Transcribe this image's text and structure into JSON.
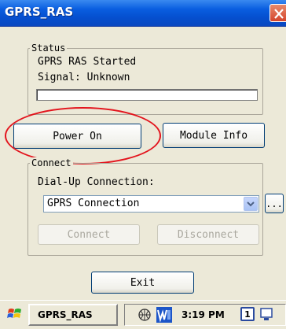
{
  "window": {
    "title": "GPRS_RAS"
  },
  "status": {
    "group_label": "Status",
    "state_text": "GPRS RAS Started",
    "signal_text": "Signal: Unknown",
    "signal_progress": 0
  },
  "buttons": {
    "power_on": "Power On",
    "module_info": "Module Info",
    "exit": "Exit"
  },
  "connect": {
    "group_label": "Connect",
    "dialup_label": "Dial-Up Connection:",
    "selected_connection": "GPRS Connection",
    "browse_button": "...",
    "connect_button": "Connect",
    "disconnect_button": "Disconnect"
  },
  "taskbar": {
    "task_label": "GPRS_RAS",
    "time": "3:19 PM",
    "badge": "1"
  },
  "colors": {
    "titlebar": "#0a5ee0",
    "highlight": "#e3141d",
    "background": "#ece9d8"
  }
}
